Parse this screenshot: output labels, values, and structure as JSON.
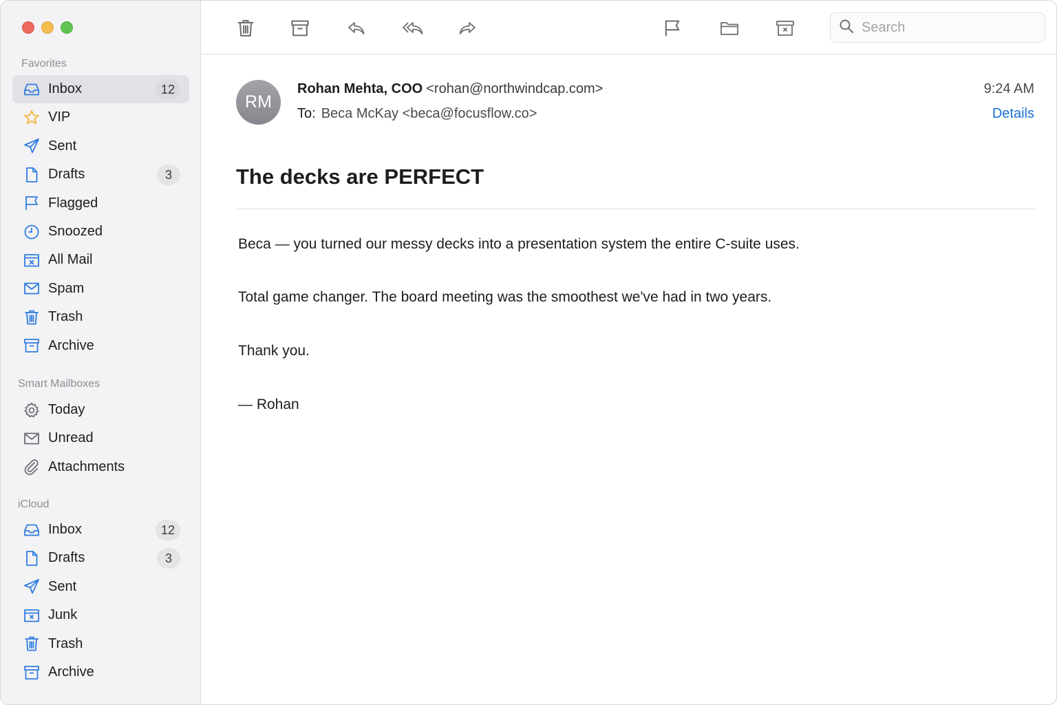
{
  "sidebar": {
    "favorites_title": "Favorites",
    "favorites": [
      {
        "label": "Inbox",
        "badge": "12",
        "icon": "inbox-icon",
        "active": true
      },
      {
        "label": "VIP",
        "badge": "",
        "icon": "star-icon"
      },
      {
        "label": "Sent",
        "badge": "",
        "icon": "sent-icon"
      },
      {
        "label": "Drafts",
        "badge": "3",
        "icon": "document-icon"
      },
      {
        "label": "Flagged",
        "badge": "",
        "icon": "flag-icon"
      },
      {
        "label": "Snoozed",
        "badge": "",
        "icon": "clock-icon"
      },
      {
        "label": "All Mail",
        "badge": "",
        "icon": "all-mail-icon"
      },
      {
        "label": "Spam",
        "badge": "",
        "icon": "envelope-icon"
      },
      {
        "label": "Trash",
        "badge": "",
        "icon": "trash-icon"
      },
      {
        "label": "Archive",
        "badge": "",
        "icon": "archive-icon"
      }
    ],
    "smart_title": "Smart Mailboxes",
    "smart": [
      {
        "label": "Today",
        "icon": "gear-icon"
      },
      {
        "label": "Unread",
        "icon": "envelope-icon"
      },
      {
        "label": "Attachments",
        "icon": "paperclip-icon"
      }
    ],
    "icloud_title": "iCloud",
    "icloud": [
      {
        "label": "Inbox",
        "badge": "12",
        "icon": "inbox-icon"
      },
      {
        "label": "Drafts",
        "badge": "3",
        "icon": "document-icon"
      },
      {
        "label": "Sent",
        "badge": "",
        "icon": "sent-icon"
      },
      {
        "label": "Junk",
        "badge": "",
        "icon": "junk-icon"
      },
      {
        "label": "Trash",
        "badge": "",
        "icon": "trash-icon"
      },
      {
        "label": "Archive",
        "badge": "",
        "icon": "archive-icon"
      }
    ]
  },
  "toolbar": {
    "buttons": [
      "trash-icon",
      "archive-icon",
      "reply-icon",
      "reply-all-icon",
      "forward-icon",
      "flag-icon",
      "folder-icon",
      "junk-icon"
    ],
    "search_placeholder": "Search",
    "search_value": ""
  },
  "message": {
    "avatar_initials": "RM",
    "from_name": "Rohan Mehta, COO",
    "from_address": "<rohan@northwindcap.com>",
    "to_label": "To:",
    "to_value": "Beca McKay <beca@focusflow.co>",
    "time": "9:24 AM",
    "details_link": "Details",
    "subject": "The decks are PERFECT",
    "body": [
      "Beca — you turned our messy decks into a presentation system the entire C-suite uses.",
      "Total game changer. The board meeting was the smoothest we've had in two years.",
      "Thank you.",
      "— Rohan"
    ]
  },
  "colors": {
    "accent": "#1a6fd6",
    "icon_blue": "#2f7ce0",
    "vip_star": "#f2b53a",
    "sidebar_bg": "#f3f3f5"
  }
}
